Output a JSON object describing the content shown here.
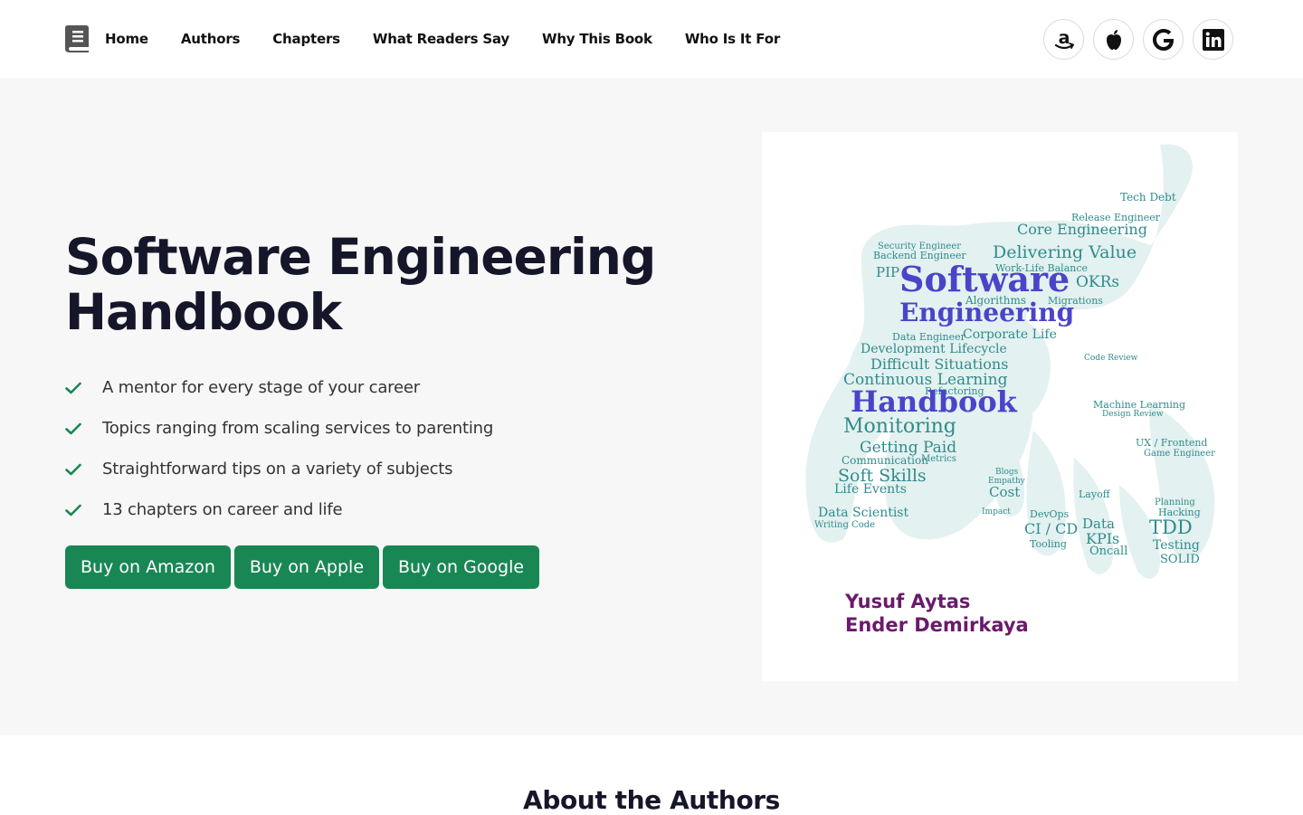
{
  "nav": {
    "links": [
      "Home",
      "Authors",
      "Chapters",
      "What Readers Say",
      "Why This Book",
      "Who Is It For"
    ],
    "socials": [
      "amazon-icon",
      "apple-icon",
      "google-icon",
      "linkedin-icon"
    ]
  },
  "hero": {
    "title_line1": "Software Engineering",
    "title_line2": "Handbook",
    "features": [
      "A mentor for every stage of your career",
      "Topics ranging from scaling services to parenting",
      "Straightforward tips on a variety of subjects",
      "13 chapters on career and life"
    ],
    "buttons": [
      "Buy on Amazon",
      "Buy on Apple",
      "Buy on Google"
    ]
  },
  "cover": {
    "title_1": "Software",
    "title_2": "Engineering",
    "title_3": "Handbook",
    "authors": [
      "Yusuf Aytas",
      "Ender Demirkaya"
    ],
    "words": [
      "Tech Debt",
      "Release Engineer",
      "Core Engineering",
      "Delivering Value",
      "Work-Life Balance",
      "OKRs",
      "PIP",
      "Backend Engineer",
      "Security Engineer",
      "Algorithms",
      "Migrations",
      "Corporate Life",
      "Data Engineer",
      "Development Lifecycle",
      "Difficult Situations",
      "Continuous Learning",
      "Refactoring",
      "Monitoring",
      "Getting Paid",
      "Communication",
      "Metrics",
      "Soft Skills",
      "Life Events",
      "Data Scientist",
      "Writing Code",
      "Cost",
      "CI / CD",
      "Tooling",
      "DevOps",
      "Layoff",
      "Data",
      "KPIs",
      "Oncall",
      "TDD",
      "Testing",
      "SOLID",
      "UX / Frontend",
      "Game Engineer",
      "Machine Learning",
      "Design Review",
      "Code Review",
      "Planning",
      "Hacking",
      "Blogs",
      "Empathy",
      "Impact"
    ]
  },
  "about": {
    "title": "About the Authors"
  },
  "colors": {
    "accent_green": "#198754",
    "cover_title": "#4b44c9",
    "cover_authors": "#6b1a6b",
    "cloud_teal": "#2f8c8c"
  }
}
